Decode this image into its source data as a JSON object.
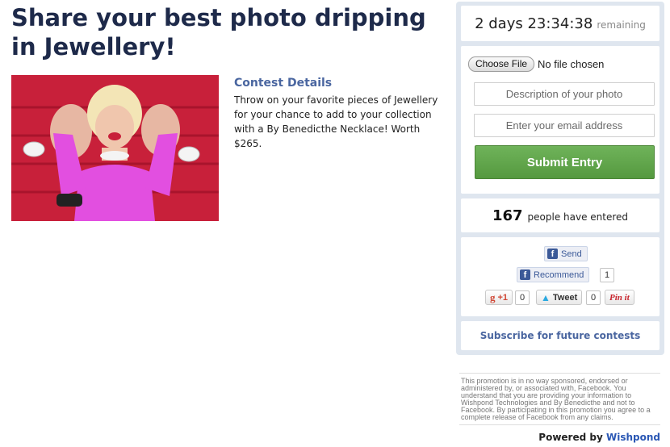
{
  "contest": {
    "title": "Share your best photo dripping in Jewellery!",
    "details_heading": "Contest Details",
    "details_body": "Throw on your favorite pieces of Jewellery for your chance to add to your collection with a By Benedicthe Necklace! Worth $265."
  },
  "timer": {
    "value": "2 days 23:34:38",
    "suffix": "remaining"
  },
  "form": {
    "file_button": "Choose File",
    "file_status": "No file chosen",
    "description_placeholder": "Description of your photo",
    "email_placeholder": "Enter your email address",
    "submit_label": "Submit Entry"
  },
  "entries": {
    "count": "167",
    "label": "people have entered"
  },
  "social": {
    "send_label": "Send",
    "recommend_label": "Recommend",
    "recommend_count": "1",
    "gplus_label": "+1",
    "gplus_count": "0",
    "tweet_label": "Tweet",
    "tweet_count": "0",
    "pin_label": "Pin it"
  },
  "subscribe_label": "Subscribe for future contests",
  "disclaimer": "This promotion is in no way sponsored, endorsed or administered by, or associated with, Facebook. You understand that you are providing your information to Wishpond Technologies and By Benedicthe and not to Facebook. By participating in this promotion you agree to a complete release of Facebook from any claims.",
  "footer": {
    "powered_by": "Powered by",
    "brand": "Wishpond"
  },
  "colors": {
    "title": "#1e2a4a",
    "link": "#4a66a0",
    "submit_green": "#5fa64a",
    "sidebar_bg": "#dfe6ef",
    "facebook_blue": "#3b5998"
  }
}
